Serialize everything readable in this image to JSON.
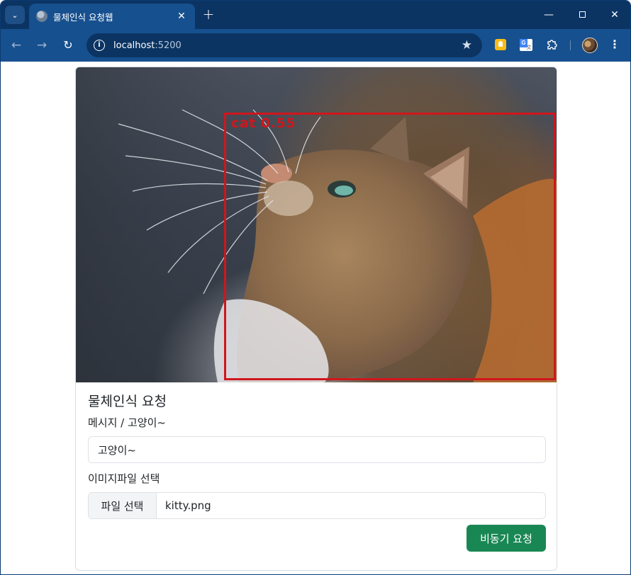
{
  "browser": {
    "tab_title": "물체인식 요청웹",
    "tab_close": "✕",
    "new_tab": "+",
    "url_host": "localhost",
    "url_port": ":5200",
    "window_controls": {
      "minimize": "—",
      "close": "✕"
    }
  },
  "image": {
    "detection_label": "cat  0.55",
    "box_color": "#d0161c"
  },
  "form": {
    "title": "물체인식 요청",
    "message_label": "메시지 / 고양이~",
    "message_value": "고양이~",
    "file_label": "이미지파일 선택",
    "file_button": "파일 선택",
    "file_name": "kitty.png",
    "submit_label": "비동기 요청"
  },
  "colors": {
    "titlebar": "#0b3463",
    "toolbar": "#17508f",
    "success": "#198754"
  },
  "icons": {
    "back": "arrow-left-icon",
    "forward": "arrow-right-icon",
    "reload": "reload-icon",
    "info": "info-icon",
    "star": "star-icon",
    "extensions": "puzzle-icon",
    "menu": "more-vertical-icon"
  }
}
